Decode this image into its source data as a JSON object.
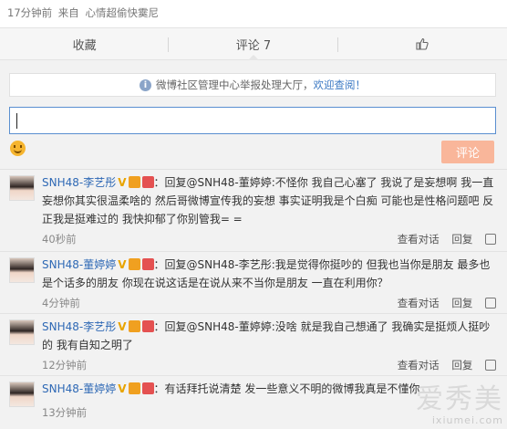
{
  "header": {
    "time": "17分钟前",
    "source_prefix": "来自",
    "source": "心情超偷快霙尼"
  },
  "actionbar": {
    "repost": "收藏",
    "comment": "评论 7",
    "like_icon": "thumbs-up-icon"
  },
  "notice": {
    "text": "微博社区管理中心举报处理大厅，",
    "link": "欢迎查阅！"
  },
  "compose": {
    "submit": "评论"
  },
  "comments": [
    {
      "user": "SNH48-李艺彤",
      "text": "：回复@SNH48-董婷婷:不怪你 我自己心塞了 我说了是妄想啊 我一直妄想你其实很温柔啥的 然后哥微博宣传我的妄想 事实证明我是个白痴 可能也是性格问题吧 反正我是挺难过的 我快抑郁了你别管我= =",
      "time": "40秒前",
      "view": "查看对话",
      "reply": "回复"
    },
    {
      "user": "SNH48-董婷婷",
      "text": "：回复@SNH48-李艺彤:我是觉得你挺吵的 但我也当你是朋友 最多也是个话多的朋友 你现在说这话是在说从来不当你是朋友 一直在利用你？",
      "time": "4分钟前",
      "view": "查看对话",
      "reply": "回复"
    },
    {
      "user": "SNH48-李艺彤",
      "text": "：回复@SNH48-董婷婷:没啥 就是我自己想通了 我确实是挺烦人挺吵的 我有自知之明了",
      "time": "12分钟前",
      "view": "查看对话",
      "reply": "回复"
    },
    {
      "user": "SNH48-董婷婷",
      "text": "：有话拜托说清楚 发一些意义不明的微博我真是不懂你",
      "time": "13分钟前",
      "view": "",
      "reply": ""
    }
  ],
  "watermark": {
    "main": "爱秀美",
    "sub": "ixiumei.com"
  }
}
